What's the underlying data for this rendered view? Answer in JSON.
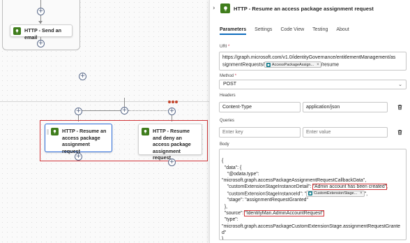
{
  "canvas": {
    "top_action": {
      "title": "HTTP - Send an email"
    },
    "parallel_actions": [
      {
        "title": "HTTP - Resume an access package assignment request"
      },
      {
        "title": "HTTP - Resume and deny an access package assignment request"
      }
    ],
    "add_step_symbol": "+"
  },
  "panel": {
    "title": "HTTP - Resume an access package assignment request",
    "tabs": [
      "Parameters",
      "Settings",
      "Code View",
      "Testing",
      "About"
    ],
    "active_tab": "Parameters",
    "uri": {
      "label": "URI",
      "required_mark": "*",
      "line1": "https://graph.microsoft.com/v1.0/identityGovernance/entitlementManagement/as",
      "line2_prefix": "signmentRequests/",
      "token_label": "AccessPackageAssign...",
      "token_close": "×",
      "line2_suffix": "/resume"
    },
    "method": {
      "label": "Method",
      "required_mark": "*",
      "value": "POST"
    },
    "headers": {
      "label": "Headers",
      "key": "Content-Type",
      "value": "application/json"
    },
    "queries": {
      "label": "Queries",
      "key_placeholder": "Enter key",
      "value_placeholder": "Enter value"
    },
    "body": {
      "label": "Body",
      "lines": {
        "l1": "{",
        "l2": "  \"data\": {",
        "l3": "    \"@odata.type\":",
        "l4": "\"microsoft.graph.accessPackageAssignmentRequestCallbackData\",",
        "l5_prefix": "    \"customExtensionStageInstanceDetail\": ",
        "l5_highlight": "\"Admin account has been created\"",
        "l5_suffix": ",",
        "l6_prefix": "    \"customExtensionStageInstanceId\": \"",
        "l6_token": "CustomExtensionStage...",
        "l6_token_close": "×",
        "l6_suffix": "\",",
        "l7": "    \"stage\": \"assignmentRequestGranted\"",
        "l8": "  },",
        "l9_prefix": "  \"source\": ",
        "l9_highlight": "\"IdentityMan.AdminAccountRequest\"",
        "l9_suffix": ",",
        "l10": "  \"type\":",
        "l11": "\"microsoft.graph.accessPackageCustomExtensionStage.assignmentRequestGrante",
        "l12": "d\"",
        "l13": "}"
      }
    }
  },
  "colors": {
    "accent": "#0f6cbd",
    "action_icon": "#3f7d1c",
    "highlight_border": "#d13438",
    "token_icon": "#0e7a8a"
  },
  "icons": {
    "panel_collapse": "chevron-right-icon",
    "action": "http-bulb-icon",
    "delete": "trash-icon",
    "dropdown": "chevron-down-icon"
  }
}
